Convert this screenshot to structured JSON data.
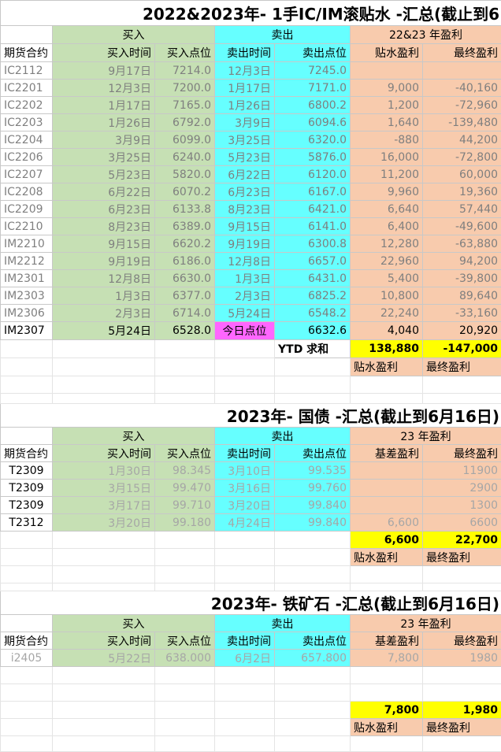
{
  "sections": {
    "icim": {
      "title": "2022&2023年- 1手IC/IM滚贴水 -汇总(截止到6",
      "group_buy": "买入",
      "group_sell": "卖出",
      "group_profit": "22&23 年盈利",
      "headers": [
        "期货合约",
        "买入时间",
        "买入点位",
        "卖出时间",
        "卖出点位",
        "贴水盈利",
        "最终盈利"
      ],
      "rows": [
        [
          "IC2112",
          "9月17日",
          "7214.0",
          "12月3日",
          "7245.0",
          "",
          ""
        ],
        [
          "IC2201",
          "12月3日",
          "7200.0",
          "1月17日",
          "7171.0",
          "9,000",
          "-40,160"
        ],
        [
          "IC2202",
          "1月17日",
          "7165.0",
          "1月26日",
          "6800.2",
          "1,200",
          "-72,960"
        ],
        [
          "IC2203",
          "1月26日",
          "6792.0",
          "3月9日",
          "6094.6",
          "1,640",
          "-139,480"
        ],
        [
          "IC2204",
          "3月9日",
          "6099.0",
          "3月25日",
          "6320.0",
          "-880",
          "44,200"
        ],
        [
          "IC2206",
          "3月25日",
          "6240.0",
          "5月23日",
          "5876.0",
          "16,000",
          "-72,800"
        ],
        [
          "IC2207",
          "5月23日",
          "5820.0",
          "6月22日",
          "6120.0",
          "11,200",
          "60,000"
        ],
        [
          "IC2208",
          "6月22日",
          "6070.2",
          "6月23日",
          "6167.0",
          "9,960",
          "19,360"
        ],
        [
          "IC2209",
          "6月23日",
          "6133.8",
          "8月23日",
          "6421.0",
          "6,640",
          "57,440"
        ],
        [
          "IC2210",
          "8月23日",
          "6389.0",
          "9月15日",
          "6141.0",
          "6,400",
          "-49,600"
        ],
        [
          "IM2210",
          "9月15日",
          "6620.2",
          "9月19日",
          "6300.8",
          "12,280",
          "-63,880"
        ],
        [
          "IM2212",
          "9月19日",
          "6186.0",
          "12月8日",
          "6657.0",
          "22,960",
          "94,200"
        ],
        [
          "IM2301",
          "12月8日",
          "6630.0",
          "1月3日",
          "6431.0",
          "5,400",
          "-39,800"
        ],
        [
          "IM2303",
          "1月3日",
          "6377.0",
          "2月3日",
          "6825.2",
          "10,800",
          "89,640"
        ],
        [
          "IM2306",
          "2月3日",
          "6714.0",
          "5月24日",
          "6548.2",
          "22,240",
          "-33,160"
        ]
      ],
      "last_row": [
        "IM2307",
        "5月24日",
        "6528.0",
        "今日点位",
        "6632.6",
        "4,040",
        "20,920"
      ],
      "total_label": "YTD 求和",
      "total_discount": "138,880",
      "total_final": "-147,000",
      "foot_discount": "贴水盈利",
      "foot_final": "最终盈利"
    },
    "bond": {
      "title": "2023年- 国债 -汇总(截止到6月16日)",
      "group_buy": "买入",
      "group_sell": "卖出",
      "group_profit": "23 年盈利",
      "headers": [
        "期货合约",
        "买入时间",
        "买入点位",
        "卖出时间",
        "卖出点位",
        "基差盈利",
        "最终盈利"
      ],
      "rows": [
        [
          "T2309",
          "1月30日",
          "98.345",
          "3月10日",
          "99.535",
          "",
          "11900"
        ],
        [
          "T2309",
          "3月15日",
          "99.470",
          "3月16日",
          "99.760",
          "",
          "2900"
        ],
        [
          "T2309",
          "3月17日",
          "99.710",
          "3月20日",
          "99.840",
          "",
          "1300"
        ],
        [
          "T2312",
          "3月20日",
          "99.180",
          "4月24日",
          "99.840",
          "6,600",
          "6600"
        ]
      ],
      "total_discount": "6,600",
      "total_final": "22,700",
      "foot_discount": "贴水盈利",
      "foot_final": "最终盈利"
    },
    "ore": {
      "title": "2023年- 铁矿石 -汇总(截止到6月16日)",
      "group_buy": "买入",
      "group_sell": "卖出",
      "group_profit": "23 年盈利",
      "headers": [
        "期货合约",
        "买入时间",
        "买入点位",
        "卖出时间",
        "卖出点位",
        "基差盈利",
        "最终盈利"
      ],
      "rows": [
        [
          "i2405",
          "5月22日",
          "638.000",
          "6月2日",
          "657.800",
          "7,800",
          "1980"
        ]
      ],
      "total_discount": "7,800",
      "total_final": "1,980",
      "foot_discount": "贴水盈利",
      "foot_final": "最终盈利"
    }
  },
  "colors": {
    "buy_fill": "#c6e0b4",
    "sell_fill": "#66ffff",
    "profit_fill": "#f8cbad",
    "total_fill": "#ffff00",
    "today_fill": "#ff66ff"
  }
}
